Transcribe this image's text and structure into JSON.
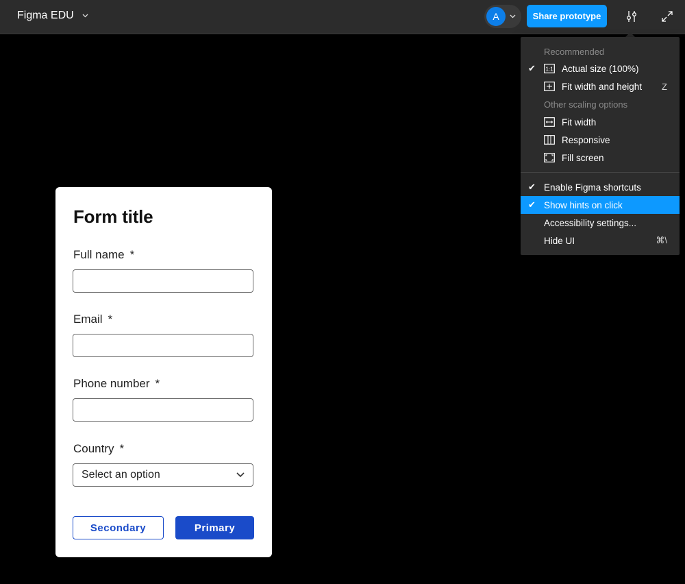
{
  "topbar": {
    "project_name": "Figma EDU",
    "avatar_initial": "A",
    "share_label": "Share prototype"
  },
  "form": {
    "title": "Form title",
    "fields": [
      {
        "label": "Full name",
        "required_mark": "*",
        "type": "text",
        "value": ""
      },
      {
        "label": "Email",
        "required_mark": "*",
        "type": "text",
        "value": ""
      },
      {
        "label": "Phone number",
        "required_mark": "*",
        "type": "text",
        "value": ""
      },
      {
        "label": "Country",
        "required_mark": "*",
        "type": "select",
        "value": "Select an option"
      }
    ],
    "secondary_button": "Secondary",
    "primary_button": "Primary"
  },
  "menu": {
    "heading_recommended": "Recommended",
    "heading_other": "Other scaling options",
    "items": [
      {
        "label": "Actual size (100%)",
        "checked": true,
        "icon": "actual-size-icon",
        "shortcut": ""
      },
      {
        "label": "Fit width and height",
        "checked": false,
        "icon": "fit-width-height-icon",
        "shortcut": "Z"
      },
      {
        "label": "Fit width",
        "checked": false,
        "icon": "fit-width-icon",
        "shortcut": ""
      },
      {
        "label": "Responsive",
        "checked": false,
        "icon": "responsive-icon",
        "shortcut": ""
      },
      {
        "label": "Fill screen",
        "checked": false,
        "icon": "fill-screen-icon",
        "shortcut": ""
      },
      {
        "label": "Enable Figma shortcuts",
        "checked": true,
        "shortcut": ""
      },
      {
        "label": "Show hints on click",
        "checked": true,
        "highlighted": true,
        "shortcut": ""
      },
      {
        "label": "Accessibility settings...",
        "checked": false,
        "shortcut": ""
      },
      {
        "label": "Hide UI",
        "checked": false,
        "shortcut": "⌘\\"
      }
    ],
    "check_glyph": "✔"
  },
  "colors": {
    "accent": "#0d99ff",
    "form_primary": "#1a4bc9",
    "avatar": "#0d7ee8"
  }
}
